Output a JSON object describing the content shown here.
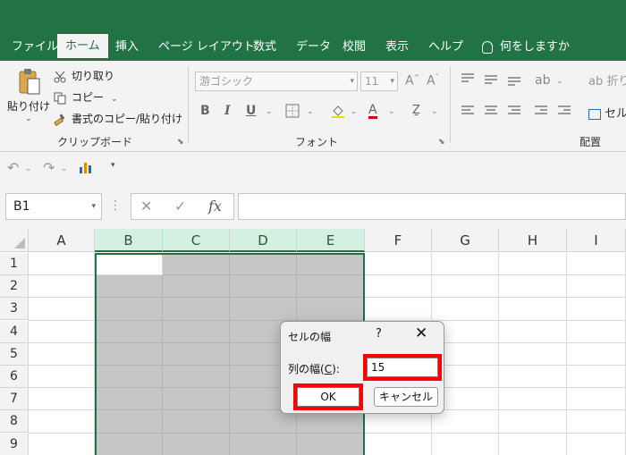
{
  "tabs": [
    "ファイル",
    "ホーム",
    "挿入",
    "ページ レイアウト",
    "数式",
    "データ",
    "校閲",
    "表示",
    "ヘルプ",
    "何をしますか"
  ],
  "clipboard": {
    "paste_label": "貼り付け",
    "cut_label": "切り取り",
    "copy_label": "コピー",
    "format_painter_label": "書式のコピー/貼り付け",
    "group_label": "クリップボード"
  },
  "font": {
    "name_value": "游ゴシック",
    "size_value": "11",
    "group_label": "フォント",
    "bold": "B",
    "italic": "I",
    "underline": "U",
    "color_a": "A",
    "grow": "A",
    "shrink": "A"
  },
  "alignment": {
    "group_label": "配置",
    "wrap_label": "折り",
    "merge_label": "セル"
  },
  "formula_bar": {
    "name_box": "B1",
    "fx": "fx",
    "cancel": "✕",
    "enter": "✓"
  },
  "columns": [
    "A",
    "B",
    "C",
    "D",
    "E",
    "F",
    "G",
    "H",
    "I"
  ],
  "rows": [
    "1",
    "2",
    "3",
    "4",
    "5",
    "6",
    "7",
    "8",
    "9"
  ],
  "dialog": {
    "title": "セルの幅",
    "help": "?",
    "close": "✕",
    "label_prefix": "列の幅(",
    "label_key": "C",
    "label_suffix": "):",
    "value": "15",
    "ok_label": "OK",
    "cancel_label": "キャンセル"
  },
  "colors": {
    "brand": "#217346",
    "highlight": "#ff0000",
    "selection": "#c6c6c6"
  }
}
